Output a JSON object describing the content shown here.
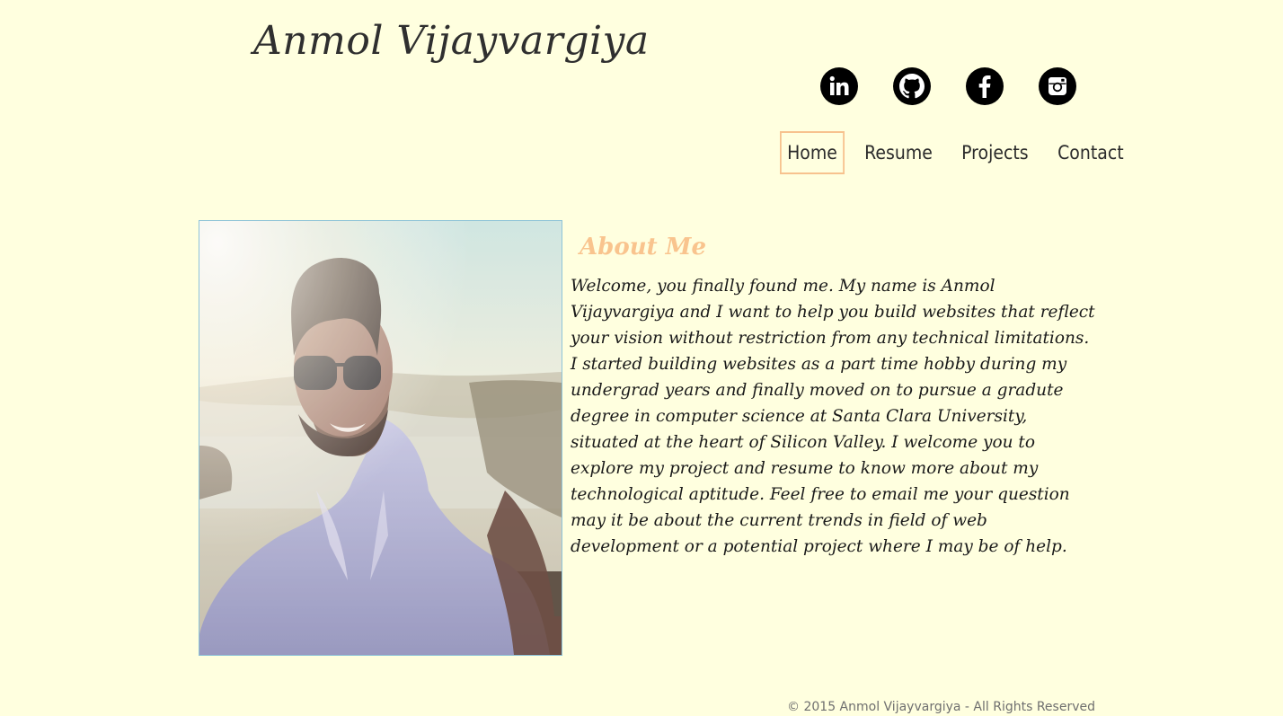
{
  "header": {
    "site_title": "Anmol Vijayvargiya"
  },
  "social": [
    {
      "name": "LinkedIn",
      "icon": "linkedin-icon"
    },
    {
      "name": "GitHub",
      "icon": "github-icon"
    },
    {
      "name": "Facebook",
      "icon": "facebook-icon"
    },
    {
      "name": "Instagram",
      "icon": "instagram-icon"
    }
  ],
  "nav": {
    "items": [
      {
        "label": "Home",
        "active": true
      },
      {
        "label": "Resume",
        "active": false
      },
      {
        "label": "Projects",
        "active": false
      },
      {
        "label": "Contact",
        "active": false
      }
    ]
  },
  "about": {
    "heading": "About Me",
    "body": "Welcome, you finally found me. My name is Anmol Vijayvargiya and I want to help you build websites that reflect your vision without restriction from any technical limitations. I started building websites as a part time hobby during my undergrad years and finally moved on to pursue a gradute degree in computer science at Santa Clara University, situated at the heart of Silicon Valley. I welcome you to explore my project and resume to know more about my technological aptitude. Feel free to email me your question may it be about the current trends in field of web development or a potential project where I may be of help."
  },
  "footer": {
    "copyright": "© 2015 Anmol Vijayvargiya - All Rights Reserved"
  },
  "colors": {
    "background": "#ffffdf",
    "accent": "#f9c48e",
    "text": "#2b2b2b"
  }
}
